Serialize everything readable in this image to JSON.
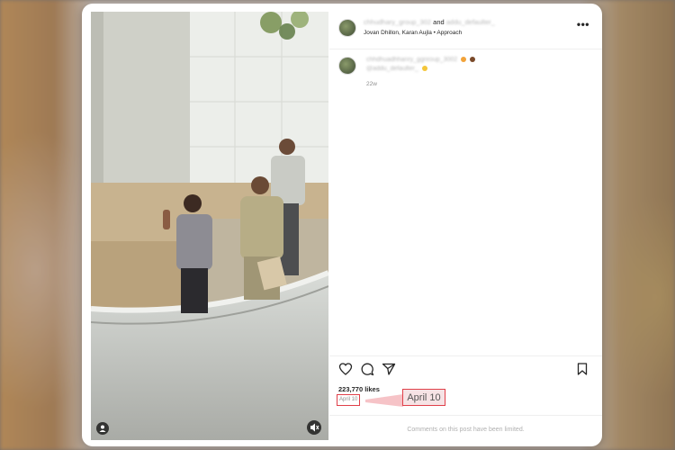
{
  "post": {
    "header": {
      "username_1": "chhudhary_group_302",
      "joiner": "and",
      "username_2": "addu_defaulter_",
      "audio": "Jovan Dhillon, Karan Aujla • Approach",
      "more_label": "•••"
    },
    "caption": {
      "username": "chhdhuadhhanry_ggnroup_3002",
      "mention": "@addu_defaulter_",
      "time": "22w"
    },
    "likes": "223,770 likes",
    "date": "April 10",
    "date_callout": "April 10",
    "comments_status": "Comments on this post have been limited."
  },
  "colors": {
    "highlight": "#e0404a",
    "text": "#262626",
    "muted": "#8e8e8e"
  },
  "icons": [
    "like-heart-icon",
    "comment-icon",
    "share-icon",
    "save-bookmark-icon",
    "user-tag-icon",
    "mute-icon",
    "more-options-icon"
  ]
}
